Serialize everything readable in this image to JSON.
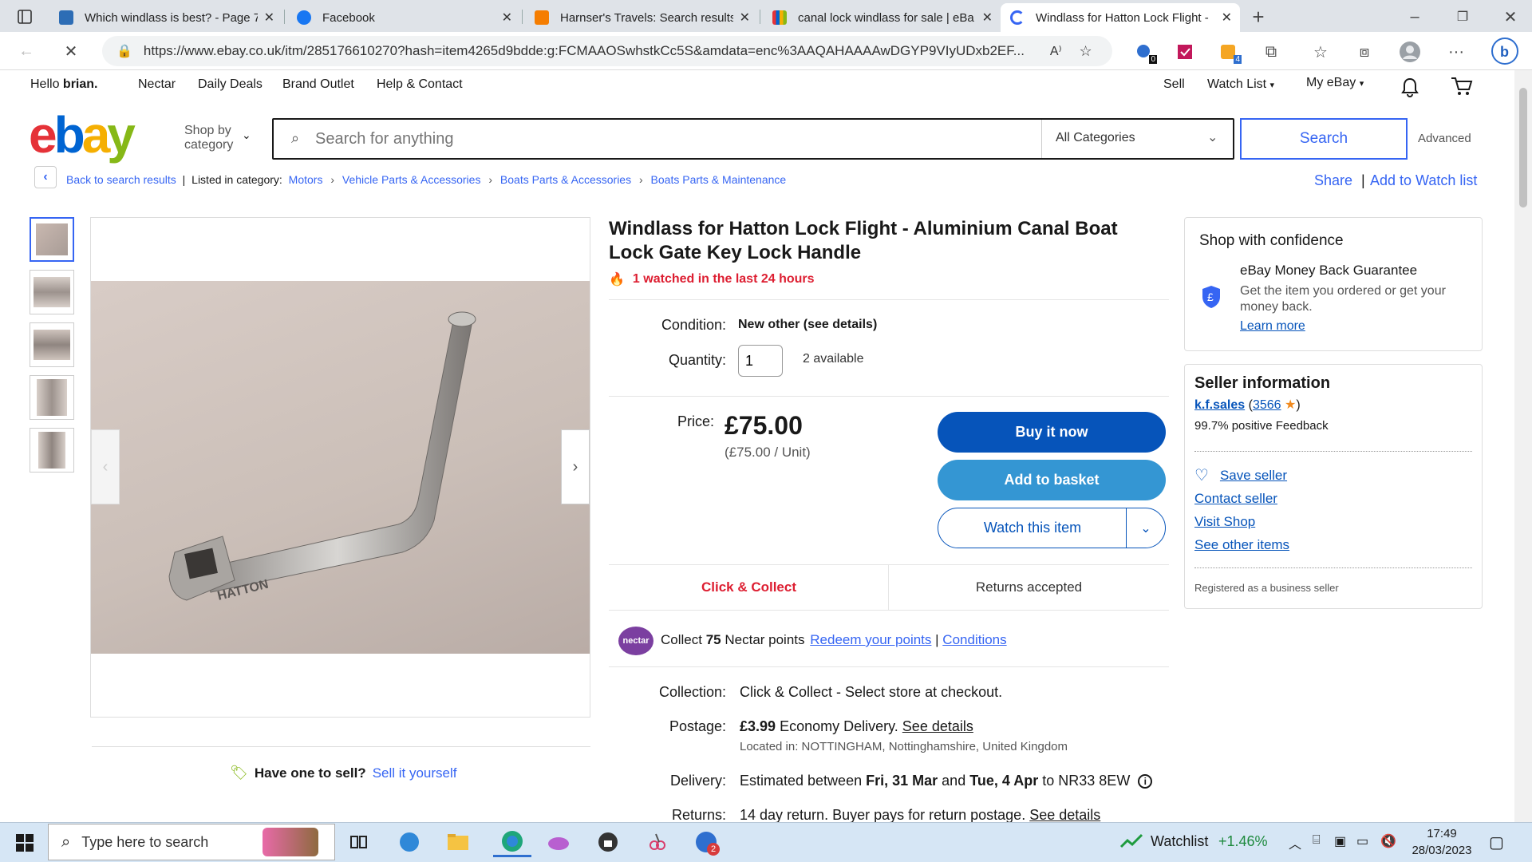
{
  "browser": {
    "tabs": [
      {
        "title": "Which windlass is best? - Page 7",
        "color": "#2d6db5"
      },
      {
        "title": "Facebook",
        "color": "#1877f2"
      },
      {
        "title": "Harnser's Travels: Search results",
        "color": "#f57d00"
      },
      {
        "title": "canal lock windlass for sale | eBa",
        "color": "#e53238"
      },
      {
        "title": "Windlass for Hatton Lock Flight - ",
        "color": "#3665f3"
      }
    ],
    "url": "https://www.ebay.co.uk/itm/285176610270?hash=item4265d9bdde:g:FCMAAOSwhstkCc5S&amdata=enc%3AAQAHAAAAwDGYP9VIyUDxb2EF...",
    "ext_badge_1": "0",
    "ext_badge_2": "4"
  },
  "topnav": {
    "greeting": "Hello",
    "user": "brian.",
    "links": [
      "Nectar",
      "Daily Deals",
      "Brand Outlet",
      "Help & Contact"
    ],
    "sell": "Sell",
    "watch_list": "Watch List",
    "my_ebay": "My eBay"
  },
  "search": {
    "shop_by_category": "Shop by category",
    "placeholder": "Search for anything",
    "category": "All Categories",
    "button": "Search",
    "advanced": "Advanced"
  },
  "breadcrumb": {
    "back": "Back to search results",
    "listed_in": "Listed in category:",
    "items": [
      "Motors",
      "Vehicle Parts & Accessories",
      "Boats Parts & Accessories",
      "Boats Parts & Maintenance"
    ],
    "share": "Share",
    "add_watch": "Add to Watch list"
  },
  "product": {
    "title": "Windlass for Hatton Lock Flight - Aluminium Canal Boat Lock Gate Key Lock Handle",
    "watched": "1 watched in the last 24 hours",
    "condition_label": "Condition:",
    "condition_value": "New other (see details)",
    "quantity_label": "Quantity:",
    "quantity_value": "1",
    "available": "2 available",
    "price_label": "Price:",
    "price": "£75.00",
    "unit_price": "(£75.00 / Unit)",
    "buy_now": "Buy it now",
    "add_basket": "Add to basket",
    "watch_item": "Watch this item",
    "click_collect": "Click & Collect",
    "returns_accepted": "Returns accepted",
    "nectar_collect": "Collect",
    "nectar_points": "75",
    "nectar_text": "Nectar points",
    "nectar_redeem": "Redeem your points",
    "nectar_conditions": "Conditions",
    "nectar_logo": "nectar",
    "image_text": "HATTON",
    "collection_label": "Collection:",
    "collection_value": "Click & Collect - Select store at checkout.",
    "postage_label": "Postage:",
    "postage_price": "£3.99",
    "postage_type": "Economy Delivery.",
    "see_details": "See details",
    "located": "Located in: NOTTINGHAM, Nottinghamshire, United Kingdom",
    "delivery_label": "Delivery:",
    "delivery_pre": "Estimated between",
    "delivery_start": "Fri, 31 Mar",
    "delivery_and": "and",
    "delivery_end": "Tue, 4 Apr",
    "delivery_to": "to NR33 8EW",
    "returns_label": "Returns:",
    "returns_value": "14 day return. Buyer pays for return postage.",
    "returns_details": "See details",
    "have_one": "Have one to sell?",
    "sell_it": "Sell it yourself"
  },
  "confidence": {
    "title": "Shop with confidence",
    "guarantee": "eBay Money Back Guarantee",
    "desc": "Get the item you ordered or get your money back.",
    "learn": "Learn more"
  },
  "seller": {
    "title": "Seller information",
    "name": "k.f.sales",
    "feedback_count": "3566",
    "positive": "99.7% positive Feedback",
    "save": "Save seller",
    "contact": "Contact seller",
    "visit": "Visit Shop",
    "other": "See other items",
    "registered": "Registered as a business seller"
  },
  "taskbar": {
    "search_placeholder": "Type here to search",
    "watchlist": "Watchlist",
    "watchlist_change": "+1.46%",
    "time": "17:49",
    "date": "28/03/2023",
    "mail_badge": "2"
  }
}
